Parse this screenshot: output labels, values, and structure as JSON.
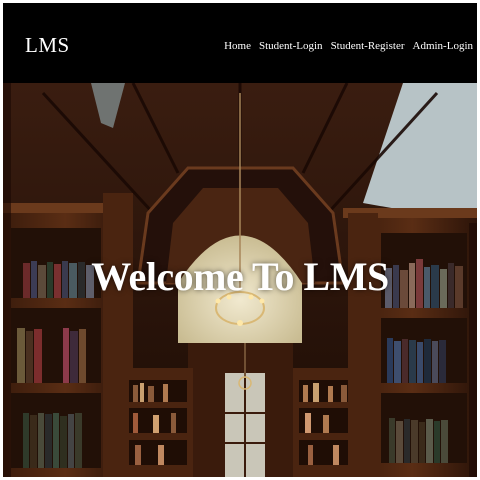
{
  "navbar": {
    "brand": "LMS",
    "links": [
      {
        "label": "Home"
      },
      {
        "label": "Student-Login"
      },
      {
        "label": "Student-Register"
      },
      {
        "label": "Admin-Login"
      }
    ]
  },
  "hero": {
    "headline": "Welcome To LMS"
  }
}
